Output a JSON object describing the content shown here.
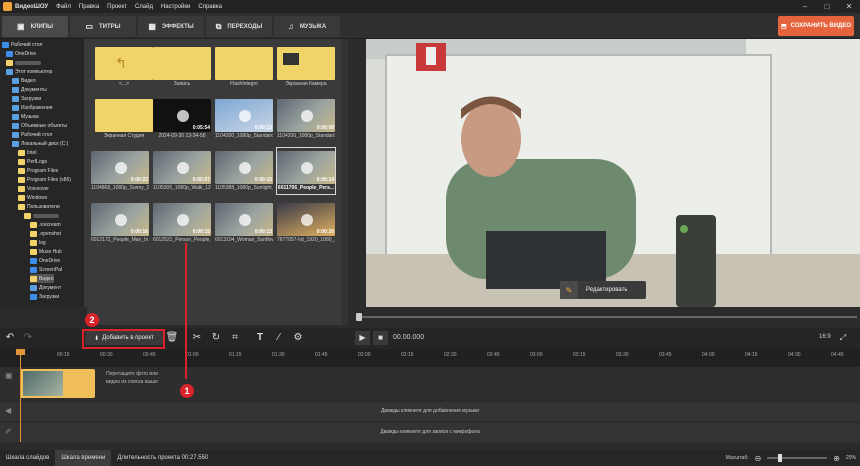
{
  "menu": {
    "app_name": "ВидеоШОУ",
    "items": [
      "Файл",
      "Правка",
      "Проект",
      "Слайд",
      "Настройки",
      "Справка"
    ]
  },
  "tabs": [
    {
      "label": "КЛИПЫ",
      "icon": "film-icon",
      "active": true
    },
    {
      "label": "ТИТРЫ",
      "icon": "titles-icon",
      "active": false
    },
    {
      "label": "ЭФФЕКТЫ",
      "icon": "effects-icon",
      "active": false
    },
    {
      "label": "ПЕРЕХОДЫ",
      "icon": "transitions-icon",
      "active": false
    },
    {
      "label": "МУЗЫКА",
      "icon": "music-icon",
      "active": false
    }
  ],
  "save_button": "СОХРАНИТЬ ВИДЕО",
  "tree": [
    "Рабочий стол",
    "OneDrive",
    "Этот компьютер",
    "Видео",
    "Документы",
    "Загрузки",
    "Изображения",
    "Музыка",
    "Объемные объекты",
    "Рабочий стол",
    "Локальный диск (C:)",
    "Intel",
    "PerfLogs",
    "Program Files",
    "Program Files (x86)",
    "Voiceover",
    "Windows",
    "Пользователи",
    ".icecream",
    ".openshot",
    "log",
    "Muse Hub",
    "OneDrive",
    "ScreenPal",
    "Видео",
    "Документ",
    "Загрузки"
  ],
  "grid": [
    {
      "caption": "<...>",
      "kind": "folder-up"
    },
    {
      "caption": "Запись",
      "kind": "folder"
    },
    {
      "caption": "FlashIntegro",
      "kind": "folder"
    },
    {
      "caption": "Экранная Камера",
      "kind": "folder-icon"
    },
    {
      "caption": "Экранная Студия",
      "kind": "folder"
    },
    {
      "caption": "2024-09-30 13-34-58",
      "kind": "video-dark",
      "duration": "0:05:54"
    },
    {
      "caption": "1104200_1080p_Standard...",
      "kind": "video-sky",
      "duration": "0:00:15"
    },
    {
      "caption": "1104200_1080p_Standard...",
      "kind": "video",
      "duration": "0:00:09"
    },
    {
      "caption": "1104868_1080p_Sunny_1...",
      "kind": "video",
      "duration": "0:00:22"
    },
    {
      "caption": "1105305_1080p_Walk_12...",
      "kind": "video",
      "duration": "0:00:07"
    },
    {
      "caption": "1105388_1080p_Sunlight_...",
      "kind": "video",
      "duration": "0:00:15"
    },
    {
      "caption": "6011706_People_Pers...",
      "kind": "video",
      "duration": "0:00:14"
    },
    {
      "caption": "6012172_People_Man_In...",
      "kind": "video",
      "duration": "0:00:16"
    },
    {
      "caption": "6012521_Person_People_...",
      "kind": "video",
      "duration": "0:00:15"
    },
    {
      "caption": "6013194_Woman_Sunflow...",
      "kind": "video",
      "duration": "0:00:12"
    },
    {
      "caption": "7677057-hd_1920_1080_...",
      "kind": "video-orange",
      "duration": "0:00:20"
    }
  ],
  "preview": {
    "edit_label": "Редактировать"
  },
  "toolbar": {
    "add_label": "Добавить в проект",
    "timecode": "00.00.000",
    "ratio": "16:9"
  },
  "ruler": [
    "00:15",
    "00:30",
    "00:45",
    "01:00",
    "01:15",
    "01:30",
    "01:45",
    "02:00",
    "02:15",
    "02:30",
    "02:45",
    "03:00",
    "03:15",
    "03:30",
    "03:45",
    "04:00",
    "04:15",
    "04:30",
    "04:45",
    "05:00",
    "05:15"
  ],
  "timeline": {
    "drop_hint": "Перетащите фото или видео из списка выше",
    "music_hint": "Дважды кликните для добавления музыки",
    "mic_hint": "Дважды кликните для записи с микрофона"
  },
  "bottom": {
    "slides_tab": "Шкала слайдов",
    "timeline_tab": "Шкала времени",
    "duration": "Длительность проекта 00:27.550",
    "scale_label": "Масштаб:",
    "zoom": "20%",
    "zoom_level": 0.2
  },
  "annotations": {
    "step1": "1",
    "step2": "2"
  },
  "colors": {
    "accent": "#e5643d",
    "annotation": "#d9232b",
    "playhead": "#e0933a"
  }
}
